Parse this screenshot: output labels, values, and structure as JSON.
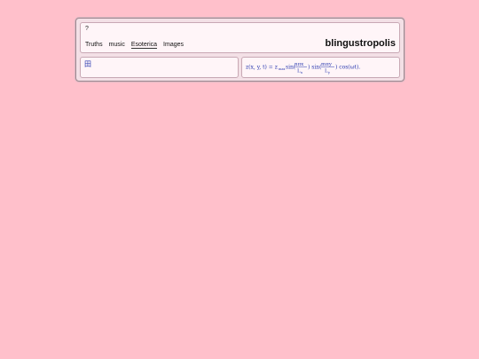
{
  "header": {
    "help_label": "?",
    "site_title": "blingustropolis",
    "nav": [
      {
        "label": "Truths"
      },
      {
        "label": "music"
      },
      {
        "label": "Esoterica"
      },
      {
        "label": "Images"
      }
    ]
  },
  "left_panel": {
    "glyph": "田"
  },
  "right_panel": {
    "formula": {
      "lhs": "z(x, y, t) = z",
      "sub": "max",
      "sin1": "sin(",
      "n1": "nπx",
      "d1": "L",
      "d1sub": "x",
      "sin2": ") sin(",
      "n2": "mπy",
      "d2": "L",
      "d2sub": "y",
      "tail": ") cos(ωt)."
    }
  },
  "colors": {
    "background": "#ffc0cb",
    "formula": "#2a3ab0"
  }
}
